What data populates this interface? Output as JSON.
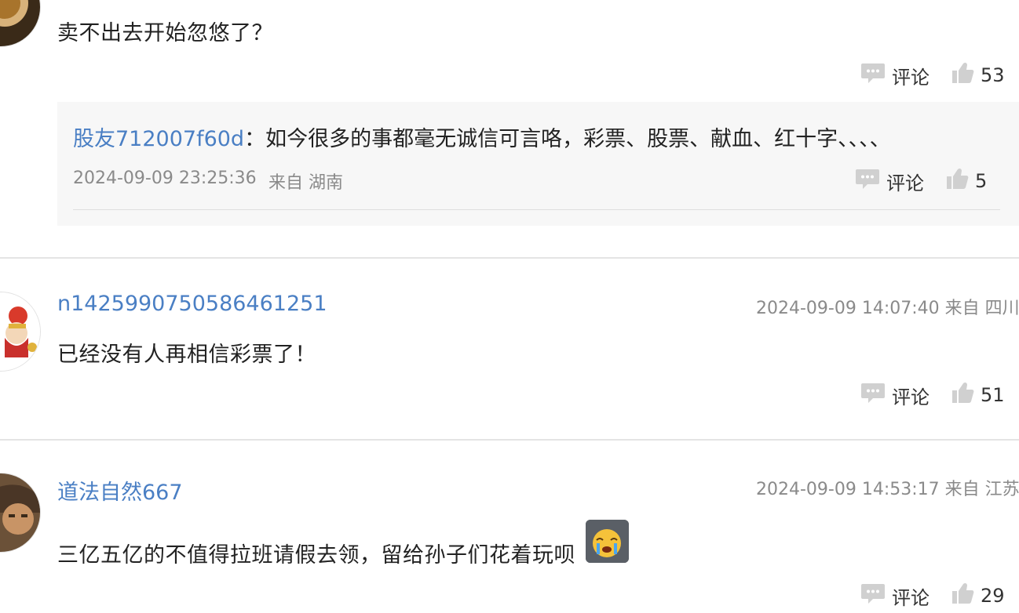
{
  "comments": [
    {
      "text": "卖不出去开始忽悠了？",
      "actions": {
        "comment_label": "评论",
        "likes": "53"
      },
      "reply": {
        "user": "股友712007f60d",
        "separator": "：",
        "text": "如今很多的事都毫无诚信可言咯，彩票、股票、献血、红十字、、、、",
        "time": "2024-09-09 23:25:36",
        "location": "来自 湖南",
        "comment_label": "评论",
        "likes": "5"
      }
    },
    {
      "user": "n1425990750586461251",
      "meta": "2024-09-09 14:07:40 来自 四川",
      "text": "已经没有人再相信彩票了！",
      "actions": {
        "comment_label": "评论",
        "likes": "51"
      }
    },
    {
      "user": "道法自然667",
      "meta": "2024-09-09 14:53:17 来自 江苏",
      "text": "三亿五亿的不值得拉班请假去领，留给孙子们花着玩呗",
      "emoji": "crying-emoji",
      "actions": {
        "comment_label": "评论",
        "likes": "29"
      }
    }
  ],
  "colors": {
    "link": "#4a7fc4",
    "meta": "#8a8a8a",
    "reply_bg": "#f7f7f7",
    "icon": "#d0d0d0"
  }
}
